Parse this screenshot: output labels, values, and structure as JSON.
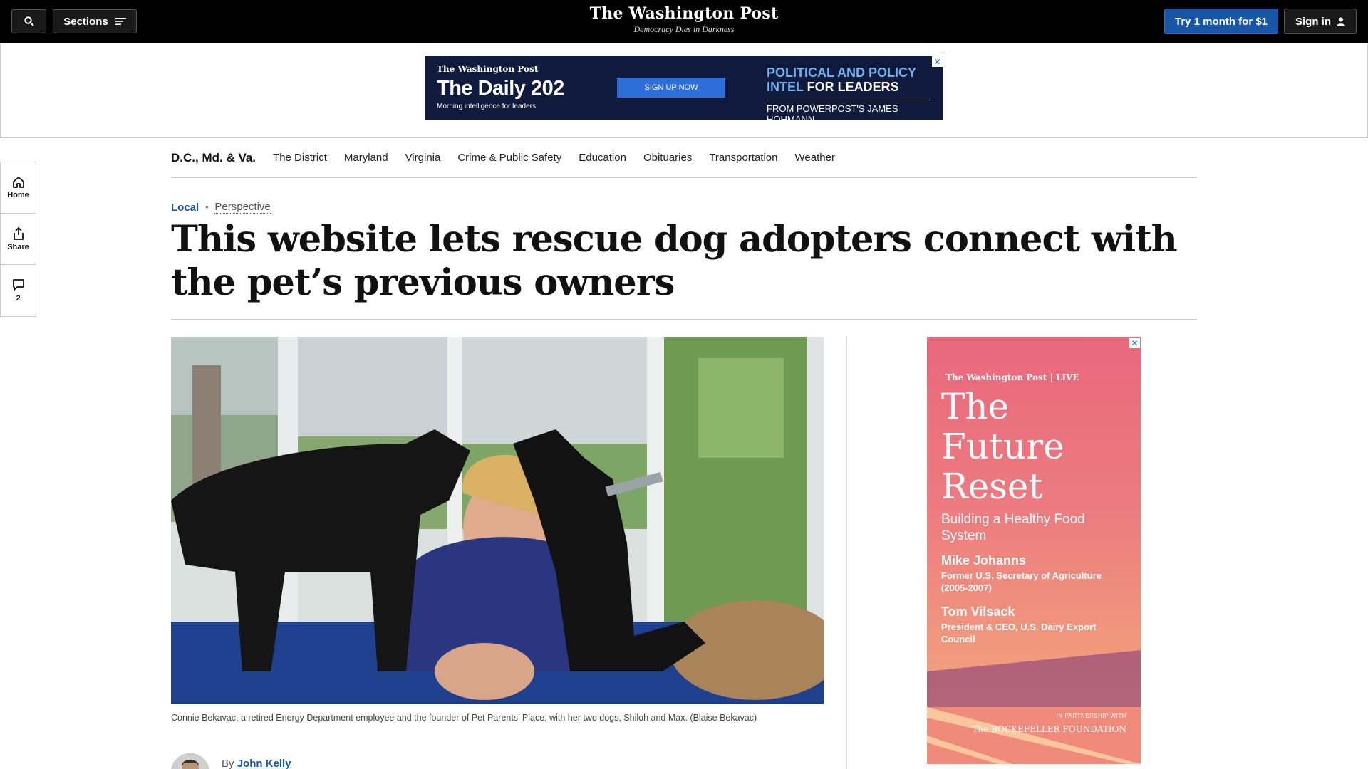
{
  "header": {
    "sections_label": "Sections",
    "logo": "The Washington Post",
    "tagline": "Democracy Dies in Darkness",
    "try_label": "Try 1 month for $1",
    "signin_label": "Sign in"
  },
  "banner_ad": {
    "logo": "The Washington Post",
    "title": "The Daily 202",
    "subtitle": "Morning intelligence for leaders",
    "cta": "SIGN UP NOW",
    "right_line1a": "POLITICAL AND POLICY",
    "right_line1b": "INTEL",
    "right_line1c": " FOR LEADERS",
    "right_line2": "FROM POWERPOST'S JAMES HOHMANN"
  },
  "section_nav": {
    "title": "D.C., Md. & Va.",
    "items": [
      "The District",
      "Maryland",
      "Virginia",
      "Crime & Public Safety",
      "Education",
      "Obituaries",
      "Transportation",
      "Weather"
    ]
  },
  "left_rail": {
    "home_label": "Home",
    "share_label": "Share",
    "comments_count": "2"
  },
  "article": {
    "kicker_section": "Local",
    "kicker_label": "Perspective",
    "headline": "This website lets rescue dog adopters connect with the pet’s previous owners",
    "caption": "Connie Bekavac, a retired Energy Department employee and the founder of Pet Parents’ Place, with her two dogs, Shiloh and Max. (Blaise Bekavac)",
    "byline_prefix": "By ",
    "author": "John Kelly"
  },
  "side_ad": {
    "logo": "The Washington Post | LIVE",
    "title": "The Future Reset",
    "subtitle": "Building a Healthy Food System",
    "speakers": [
      {
        "name": "Mike Johanns",
        "role": "Former U.S. Secretary of Agriculture (2005-2007)"
      },
      {
        "name": "Tom Vilsack",
        "role": "President & CEO, U.S. Dairy Export Council"
      }
    ],
    "partner_label": "IN PARTNERSHIP WITH",
    "partner_name": "The ROCKEFELLER FOUNDATION"
  },
  "colors": {
    "accent": "#1955a5",
    "topbar": "#000000",
    "banner_bg": "#0f1a3c"
  }
}
